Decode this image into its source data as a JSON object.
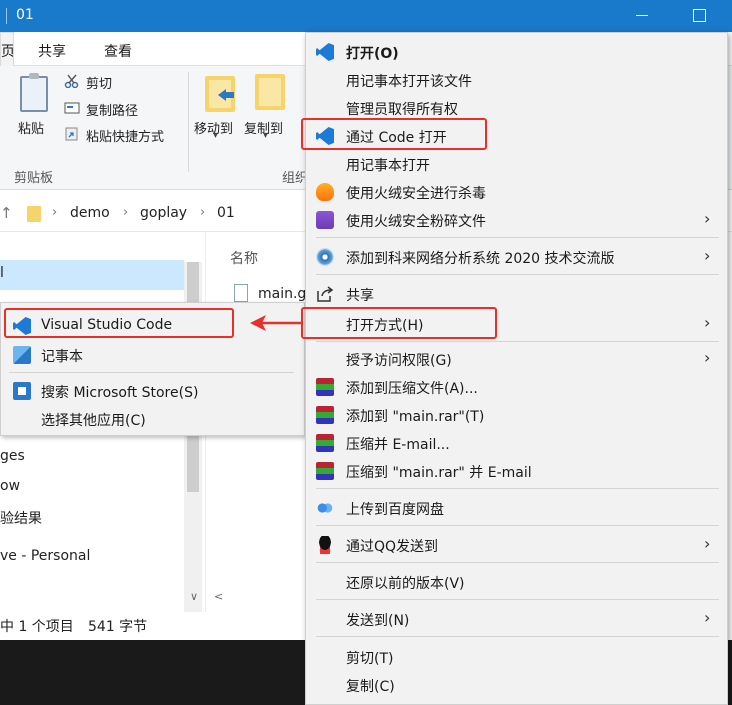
{
  "window": {
    "title": "01"
  },
  "ribbon": {
    "tabs": [
      "共享",
      "查看"
    ],
    "tab_home_partial": "页",
    "paste_label": "粘贴",
    "cut_label": "剪切",
    "copy_path_label": "复制路径",
    "paste_shortcut_label": "粘贴快捷方式",
    "move_to_label": "移动到",
    "copy_to_label": "复制到",
    "clipboard_group": "剪贴板",
    "organize_group_partial": "组织"
  },
  "address": {
    "crumbs": [
      "demo",
      "goplay",
      "01"
    ]
  },
  "navpane": {
    "items": [
      "ges",
      "ow",
      "验结果",
      "ve - Personal"
    ],
    "selected_partial": "l"
  },
  "filepane": {
    "column_name": "名称",
    "file_name": "main.g"
  },
  "statusbar": {
    "selected": "中 1 个项目",
    "size": "541 字节"
  },
  "submenu": {
    "items": [
      {
        "label": "Visual Studio Code",
        "icon": "vscode-icon"
      },
      {
        "label": "记事本",
        "icon": "notepad-icon"
      },
      {
        "label": "搜索 Microsoft Store(S)",
        "icon": "store-icon"
      },
      {
        "label": "选择其他应用(C)",
        "icon": ""
      }
    ]
  },
  "context_menu": {
    "items": [
      {
        "label": "打开(O)",
        "icon": "vscode-icon"
      },
      {
        "label": "用记事本打开该文件",
        "icon": ""
      },
      {
        "label": "管理员取得所有权",
        "icon": ""
      },
      {
        "label": "通过 Code 打开",
        "icon": "vscode-icon"
      },
      {
        "label": "用记事本打开",
        "icon": ""
      },
      {
        "label": "使用火绒安全进行杀毒",
        "icon": "huorong-icon"
      },
      {
        "label": "使用火绒安全粉碎文件",
        "icon": "shredder-icon"
      },
      {
        "label": "添加到科来网络分析系统 2020 技术交流版",
        "icon": "colasoft-icon"
      },
      {
        "label": "共享",
        "icon": "share-icon"
      },
      {
        "label": "打开方式(H)",
        "icon": ""
      },
      {
        "label": "授予访问权限(G)",
        "icon": ""
      },
      {
        "label": "添加到压缩文件(A)...",
        "icon": "winrar-icon"
      },
      {
        "label": "添加到 \"main.rar\"(T)",
        "icon": "winrar-icon"
      },
      {
        "label": "压缩并 E-mail...",
        "icon": "winrar-icon"
      },
      {
        "label": "压缩到 \"main.rar\" 并 E-mail",
        "icon": "winrar-icon"
      },
      {
        "label": "上传到百度网盘",
        "icon": "baidu-netdisk-icon"
      },
      {
        "label": "通过QQ发送到",
        "icon": "qq-icon"
      },
      {
        "label": "还原以前的版本(V)",
        "icon": ""
      },
      {
        "label": "发送到(N)",
        "icon": ""
      },
      {
        "label": "剪切(T)",
        "icon": ""
      },
      {
        "label": "复制(C)",
        "icon": ""
      }
    ]
  },
  "colors": {
    "titlebar": "#1979ca",
    "highlight": "#e8302b",
    "menu_bg": "#f2f2f2"
  }
}
